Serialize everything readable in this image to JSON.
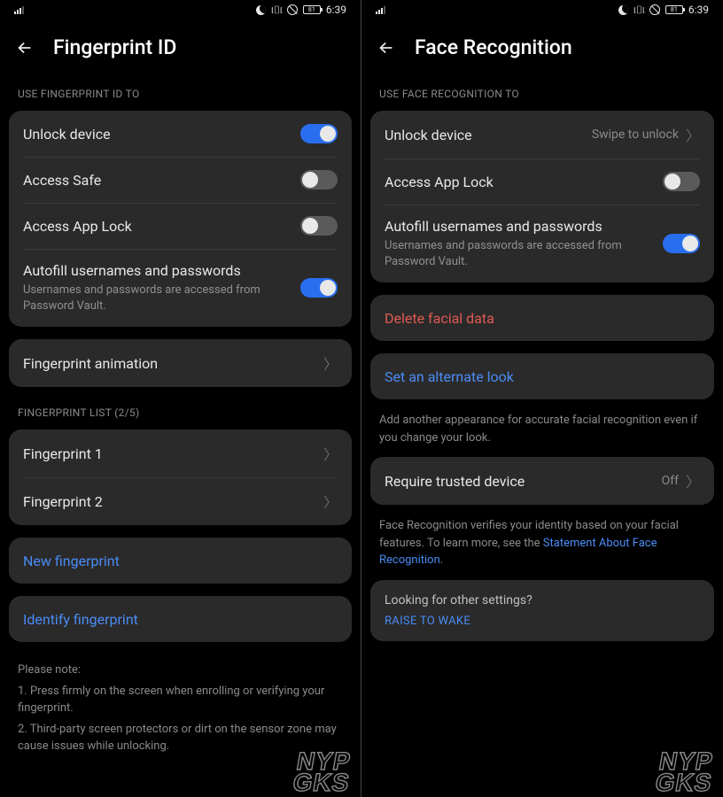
{
  "status": {
    "time": "6:39",
    "battery": "81"
  },
  "left": {
    "title": "Fingerprint ID",
    "section_use": "USE FINGERPRINT ID TO",
    "unlock": "Unlock device",
    "safe": "Access Safe",
    "applock": "Access App Lock",
    "autofill": "Autofill usernames and passwords",
    "autofill_sub": "Usernames and passwords are accessed from Password Vault.",
    "animation": "Fingerprint animation",
    "list_label": "FINGERPRINT LIST (2/5)",
    "fp1": "Fingerprint 1",
    "fp2": "Fingerprint 2",
    "new_fp": "New fingerprint",
    "identify": "Identify fingerprint",
    "note_head": "Please note:",
    "note1": "1. Press firmly on the screen when enrolling or verifying your fingerprint.",
    "note2": "2. Third-party screen protectors or dirt on the sensor zone may cause issues while unlocking."
  },
  "right": {
    "title": "Face Recognition",
    "section_use": "USE FACE RECOGNITION TO",
    "unlock": "Unlock device",
    "unlock_value": "Swipe to unlock",
    "applock": "Access App Lock",
    "autofill": "Autofill usernames and passwords",
    "autofill_sub": "Usernames and passwords are accessed from Password Vault.",
    "delete": "Delete facial data",
    "alternate": "Set an alternate look",
    "alternate_sub": "Add another appearance for accurate facial recognition even if you change your look.",
    "trusted": "Require trusted device",
    "trusted_value": "Off",
    "disclaimer_pre": "Face Recognition verifies your identity based on your facial features. To learn more, see the ",
    "disclaimer_link": "Statement About Face Recognition",
    "tips_head": "Looking for other settings?",
    "tips_link": "RAISE TO WAKE"
  },
  "watermark": {
    "l1": "NYP",
    "l2": "GKS"
  }
}
